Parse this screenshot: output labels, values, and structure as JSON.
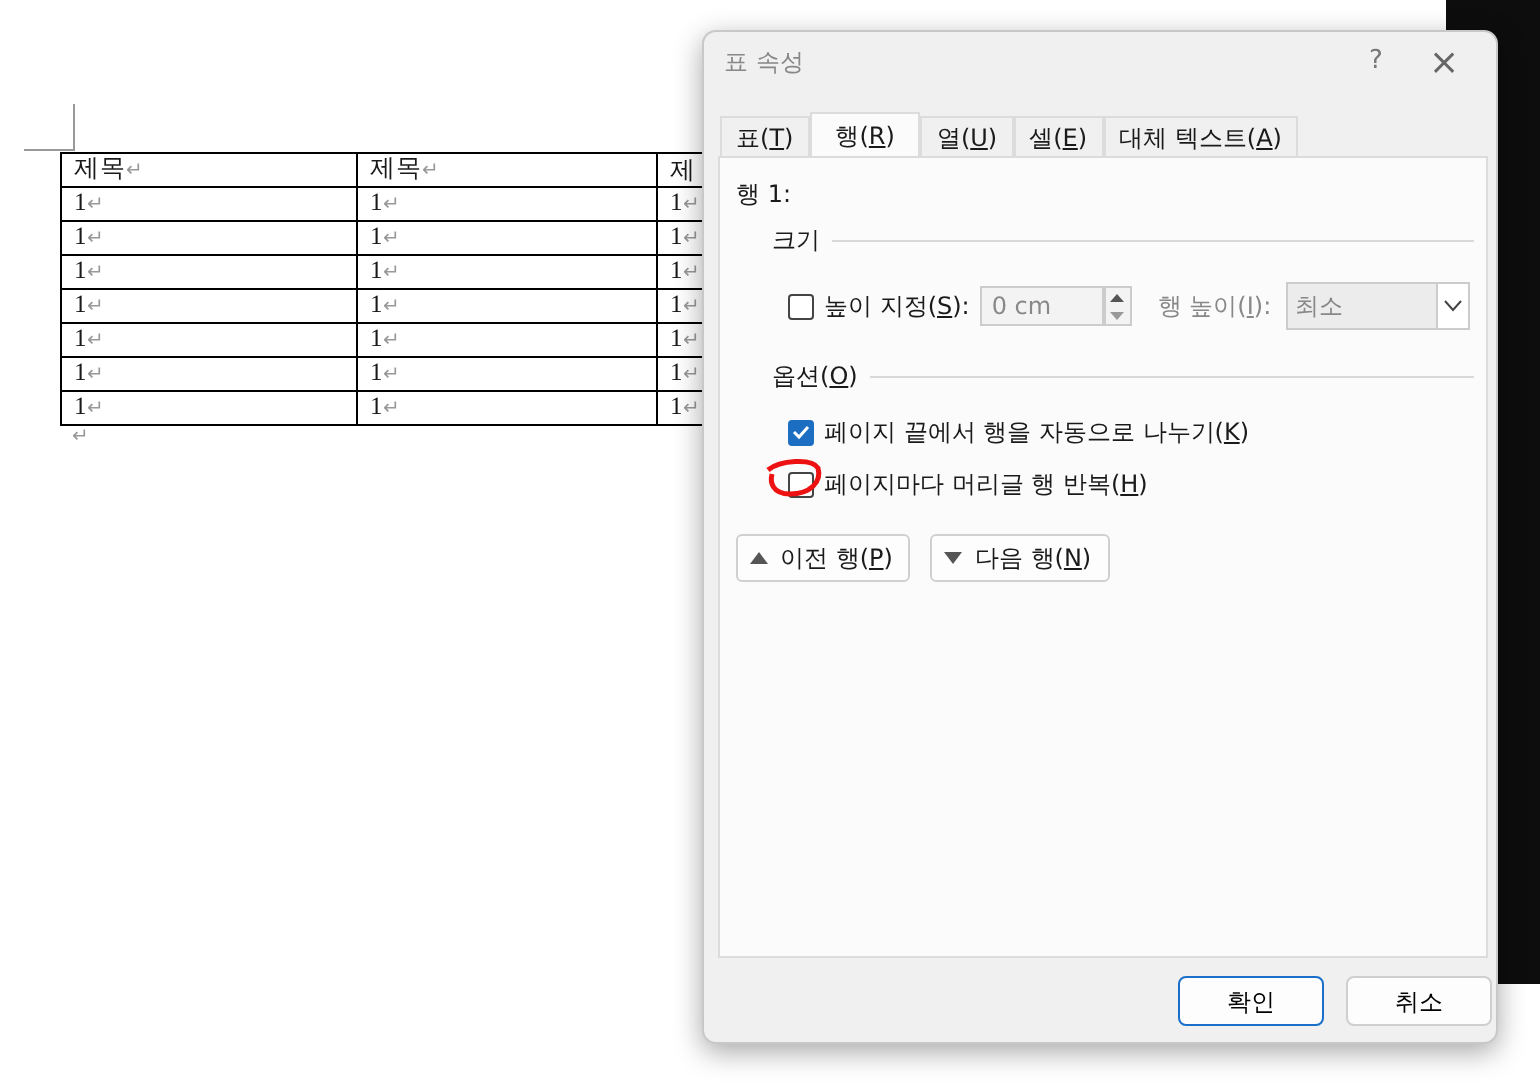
{
  "document": {
    "table": {
      "columns": [
        {
          "text": "제목",
          "mark": "↵"
        },
        {
          "text": "제목",
          "mark": "↵"
        },
        {
          "text": "제"
        }
      ],
      "rows": [
        [
          "1",
          "1",
          "1"
        ],
        [
          "1",
          "1",
          "1"
        ],
        [
          "1",
          "1",
          "1"
        ],
        [
          "1",
          "1",
          "1"
        ],
        [
          "1",
          "1",
          "1"
        ],
        [
          "1",
          "1",
          "1"
        ],
        [
          "1",
          "1",
          "1"
        ]
      ],
      "cell_mark": "↵"
    },
    "paragraph_mark": "↵"
  },
  "dialog": {
    "title": "표 속성",
    "help": "?",
    "close": "×",
    "tabs": [
      {
        "label": "표(T)",
        "selected": false
      },
      {
        "label": "행(R)",
        "selected": true
      },
      {
        "label": "열(U)",
        "selected": false
      },
      {
        "label": "셀(E)",
        "selected": false
      },
      {
        "label": "대체 텍스트(A)",
        "selected": false
      }
    ],
    "row_label": "행 1:",
    "size": {
      "heading": "크기",
      "specify_height": {
        "label": "높이 지정(S):",
        "checked": false
      },
      "height": {
        "value": "0 cm",
        "disabled": true
      },
      "height_rule_label": "행 높이(I):",
      "height_rule": {
        "value": "최소",
        "disabled": true
      }
    },
    "options": {
      "heading": "옵션(O)",
      "items": [
        {
          "label": "페이지 끝에서 행을 자동으로 나누기(K)",
          "checked": true
        },
        {
          "label": "페이지마다 머리글 행 반복(H)",
          "checked": false,
          "annotated": true
        }
      ]
    },
    "nav_buttons": [
      {
        "label": "이전 행(P)",
        "kind": "up"
      },
      {
        "label": "다음 행(N)",
        "kind": "down"
      }
    ],
    "buttons": [
      {
        "label": "확인",
        "default": true
      },
      {
        "label": "취소",
        "default": false
      }
    ]
  }
}
